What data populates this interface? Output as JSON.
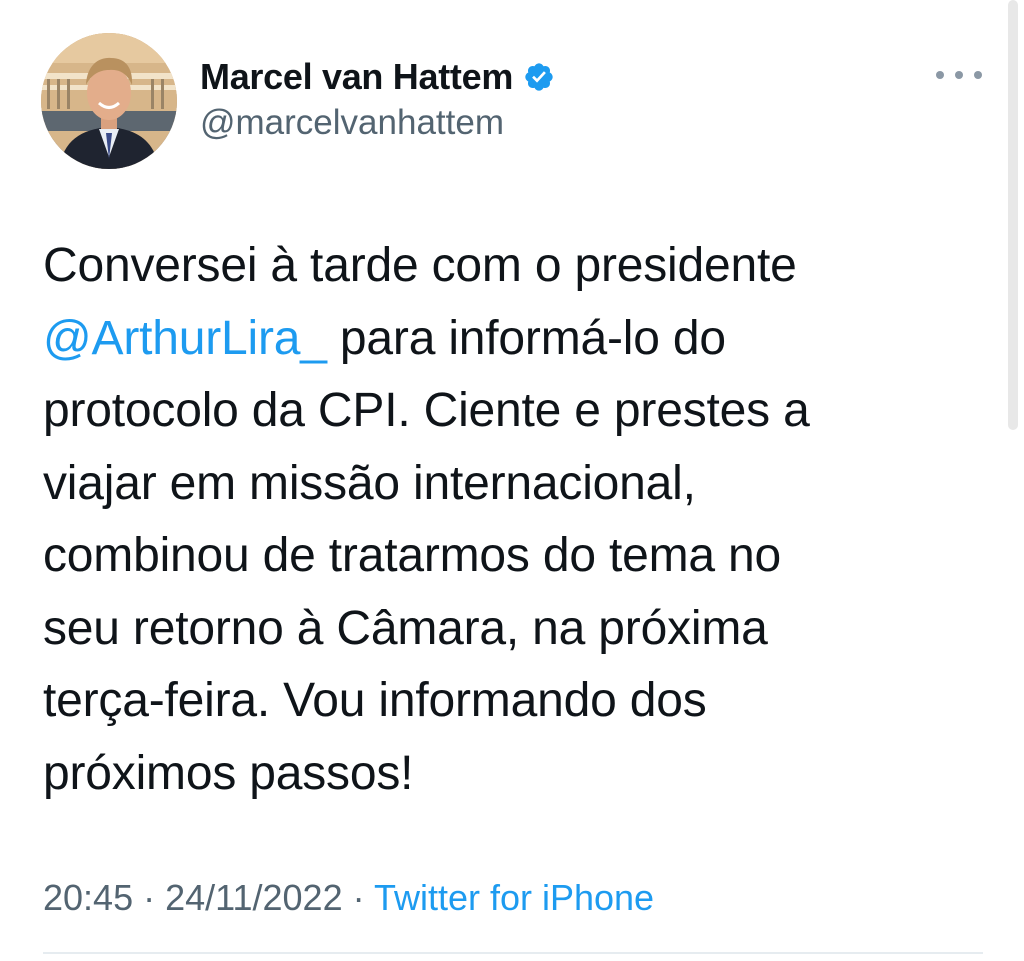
{
  "author": {
    "display_name": "Marcel van Hattem",
    "handle": "@marcelvanhattem",
    "verified": true,
    "verified_badge_color": "#1d9bf0",
    "avatar_icon": "profile-photo"
  },
  "menu": {
    "icon": "more-horizontal-icon"
  },
  "tweet": {
    "lines": [
      {
        "text": "Conversei à tarde com o presidente"
      },
      {
        "mention": "@ArthurLira_",
        "text": " para informá-lo do"
      },
      {
        "text": "protocolo da CPI. Ciente e prestes a"
      },
      {
        "text": "viajar em missão internacional,"
      },
      {
        "text": "combinou de tratarmos do tema no"
      },
      {
        "text": "seu retorno à Câmara, na próxima"
      },
      {
        "text": "terça-feira. Vou informando dos"
      },
      {
        "text": "próximos passos!"
      }
    ],
    "mention_color": "#1d9bf0"
  },
  "meta": {
    "time": "20:45",
    "separator": " · ",
    "date": "24/11/2022",
    "source": "Twitter for iPhone"
  }
}
